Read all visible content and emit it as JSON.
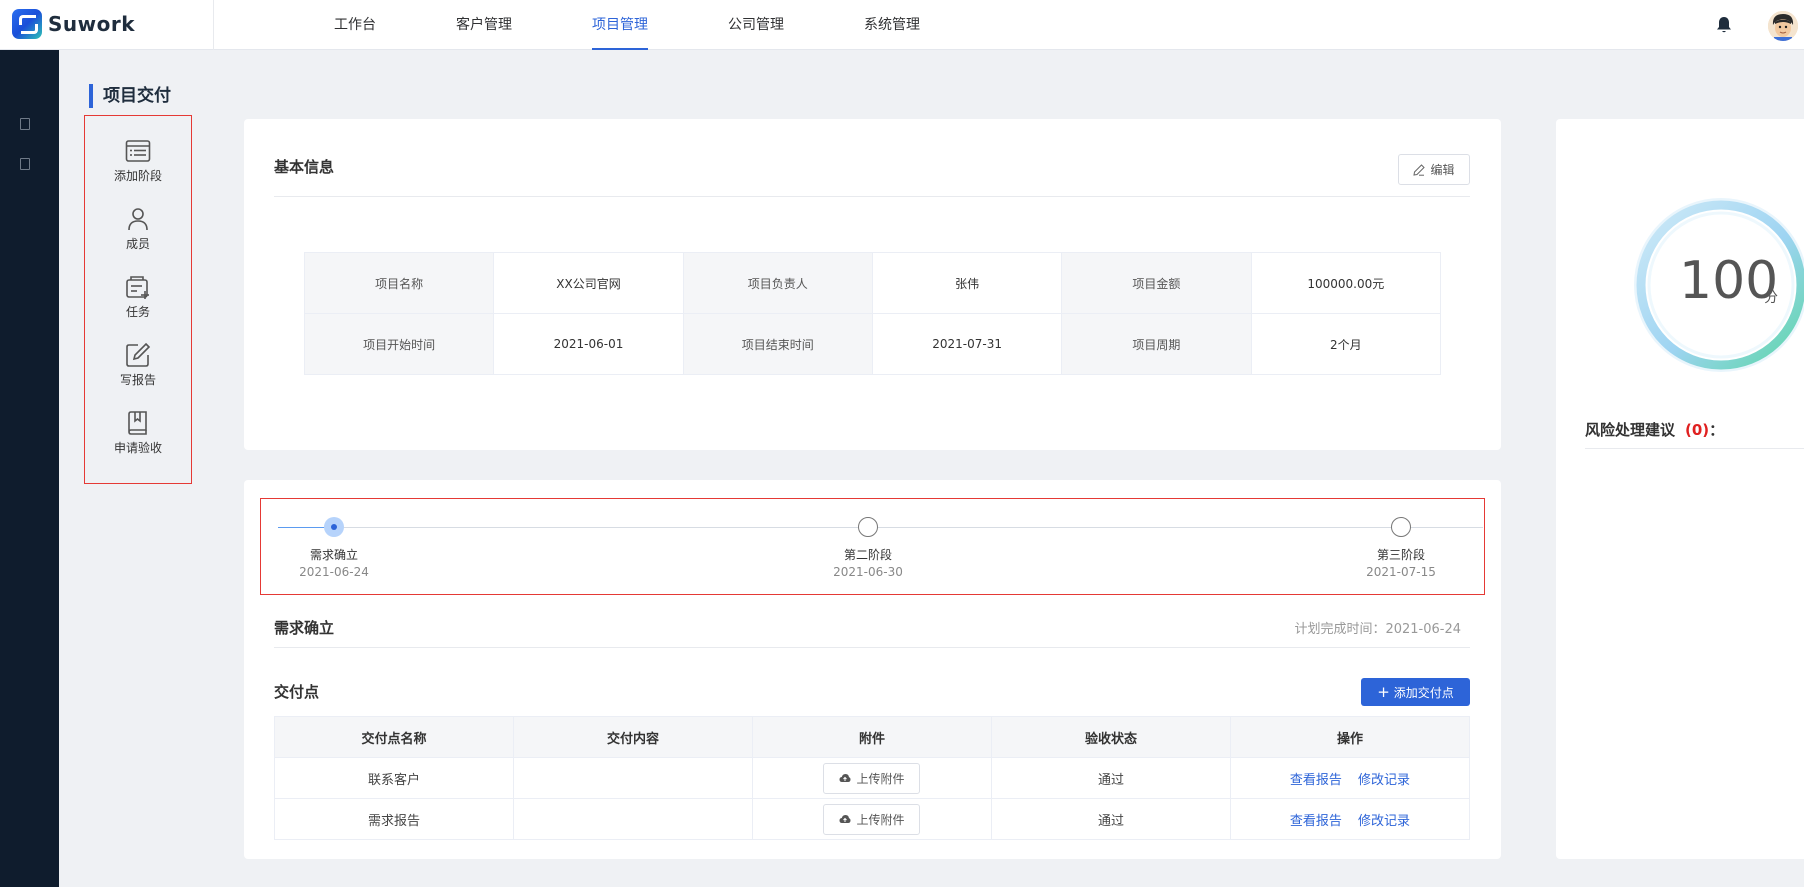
{
  "app": {
    "logo_text": "Suwork"
  },
  "nav": {
    "items": [
      {
        "label": "工作台"
      },
      {
        "label": "客户管理"
      },
      {
        "label": "项目管理"
      },
      {
        "label": "公司管理"
      },
      {
        "label": "系统管理"
      }
    ],
    "active_index": 2
  },
  "page": {
    "title": "项目交付"
  },
  "tools": [
    {
      "label": "添加阶段",
      "icon": "list-icon"
    },
    {
      "label": "成员",
      "icon": "user-icon"
    },
    {
      "label": "任务",
      "icon": "task-icon"
    },
    {
      "label": "写报告",
      "icon": "edit-icon"
    },
    {
      "label": "申请验收",
      "icon": "book-icon"
    }
  ],
  "basic_info": {
    "title": "基本信息",
    "edit_label": "编辑",
    "rows": [
      [
        {
          "k": "项目名称",
          "v": "XX公司官网"
        },
        {
          "k": "项目负责人",
          "v": "张伟"
        },
        {
          "k": "项目金额",
          "v": "100000.00元"
        }
      ],
      [
        {
          "k": "项目开始时间",
          "v": "2021-06-01"
        },
        {
          "k": "项目结束时间",
          "v": "2021-07-31"
        },
        {
          "k": "项目周期",
          "v": "2个月"
        }
      ]
    ]
  },
  "timeline": {
    "stages": [
      {
        "label": "需求确立",
        "date": "2021-06-24",
        "active": true
      },
      {
        "label": "第二阶段",
        "date": "2021-06-30",
        "active": false
      },
      {
        "label": "第三阶段",
        "date": "2021-07-15",
        "active": false
      }
    ]
  },
  "stage_detail": {
    "title": "需求确立",
    "plan_time_label": "计划完成时间：2021-06-24"
  },
  "deliverables": {
    "title": "交付点",
    "add_label": "添加交付点",
    "columns": [
      "交付点名称",
      "交付内容",
      "附件",
      "验收状态",
      "操作"
    ],
    "upload_label": "上传附件",
    "view_label": "查看报告",
    "history_label": "修改记录",
    "rows": [
      {
        "name": "联系客户",
        "content": "",
        "status": "通过"
      },
      {
        "name": "需求报告",
        "content": "",
        "status": "通过"
      }
    ]
  },
  "score": {
    "value": "100",
    "unit": "分",
    "risk_label": "风险处理建议",
    "risk_count": "(0)",
    "risk_colon": "："
  },
  "colors": {
    "accent": "#2d64d8",
    "danger": "#e02020",
    "rail": "#0f1c2d"
  }
}
